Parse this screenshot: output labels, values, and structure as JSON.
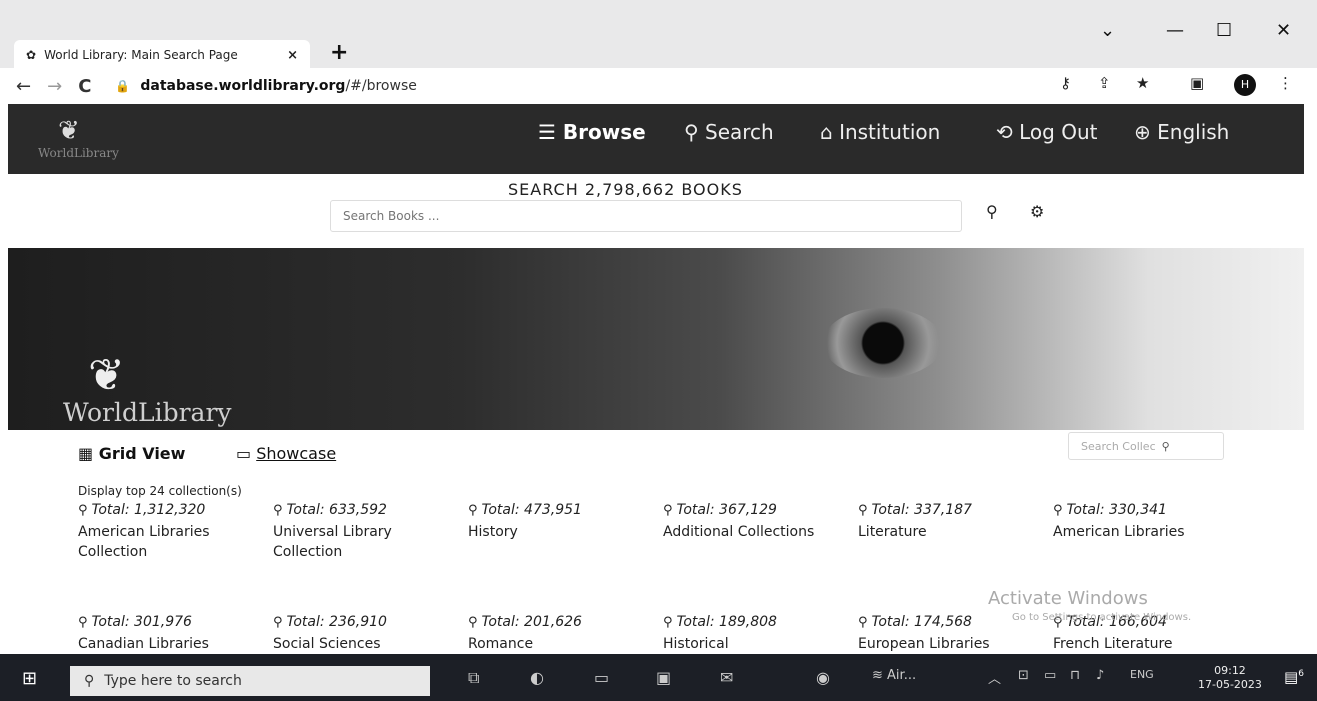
{
  "browser": {
    "tab_title": "World Library: Main Search Page",
    "tab_close": "×",
    "new_tab": "+",
    "url_host": "database.worldlibrary.org",
    "url_path": "/#/browse",
    "profile_initial": "H",
    "back": "←",
    "forward": "→",
    "reload": "C",
    "minimize": "—",
    "maximize": "☐",
    "close": "✕",
    "chevron": "⌄"
  },
  "site": {
    "logo_text": "WorldLibrary",
    "nav": {
      "browse": "Browse",
      "search": "Search",
      "institution": "Institution",
      "logout": "Log Out",
      "language": "English"
    }
  },
  "search": {
    "title": "SEARCH 2,798,662 BOOKS",
    "placeholder": "Search Books ..."
  },
  "banner": {
    "logo_text": "WorldLibrary"
  },
  "views": {
    "grid": "Grid View",
    "showcase": "Showcase",
    "search_collections_placeholder": "Search Collec"
  },
  "display_text": "Display top 24 collection(s)",
  "collections": [
    {
      "total": "Total: 1,312,320",
      "name": "American Libraries Collection"
    },
    {
      "total": "Total: 633,592",
      "name": "Universal Library Collection"
    },
    {
      "total": "Total: 473,951",
      "name": "History"
    },
    {
      "total": "Total: 367,129",
      "name": "Additional Collections"
    },
    {
      "total": "Total: 337,187",
      "name": "Literature"
    },
    {
      "total": "Total: 330,341",
      "name": "American Libraries"
    },
    {
      "total": "Total: 301,976",
      "name": "Canadian Libraries"
    },
    {
      "total": "Total: 236,910",
      "name": "Social Sciences"
    },
    {
      "total": "Total: 201,626",
      "name": "Romance"
    },
    {
      "total": "Total: 189,808",
      "name": "Historical"
    },
    {
      "total": "Total: 174,568",
      "name": "European Libraries"
    },
    {
      "total": "Total: 166,604",
      "name": "French Literature"
    }
  ],
  "watermark": {
    "title": "Activate Windows",
    "subtitle": "Go to Settings to activate Windows."
  },
  "taskbar": {
    "search_placeholder": "Type here to search",
    "app_label": "Air...",
    "language": "ENG",
    "time": "09:12",
    "date": "17-05-2023",
    "notification_count": "6"
  }
}
